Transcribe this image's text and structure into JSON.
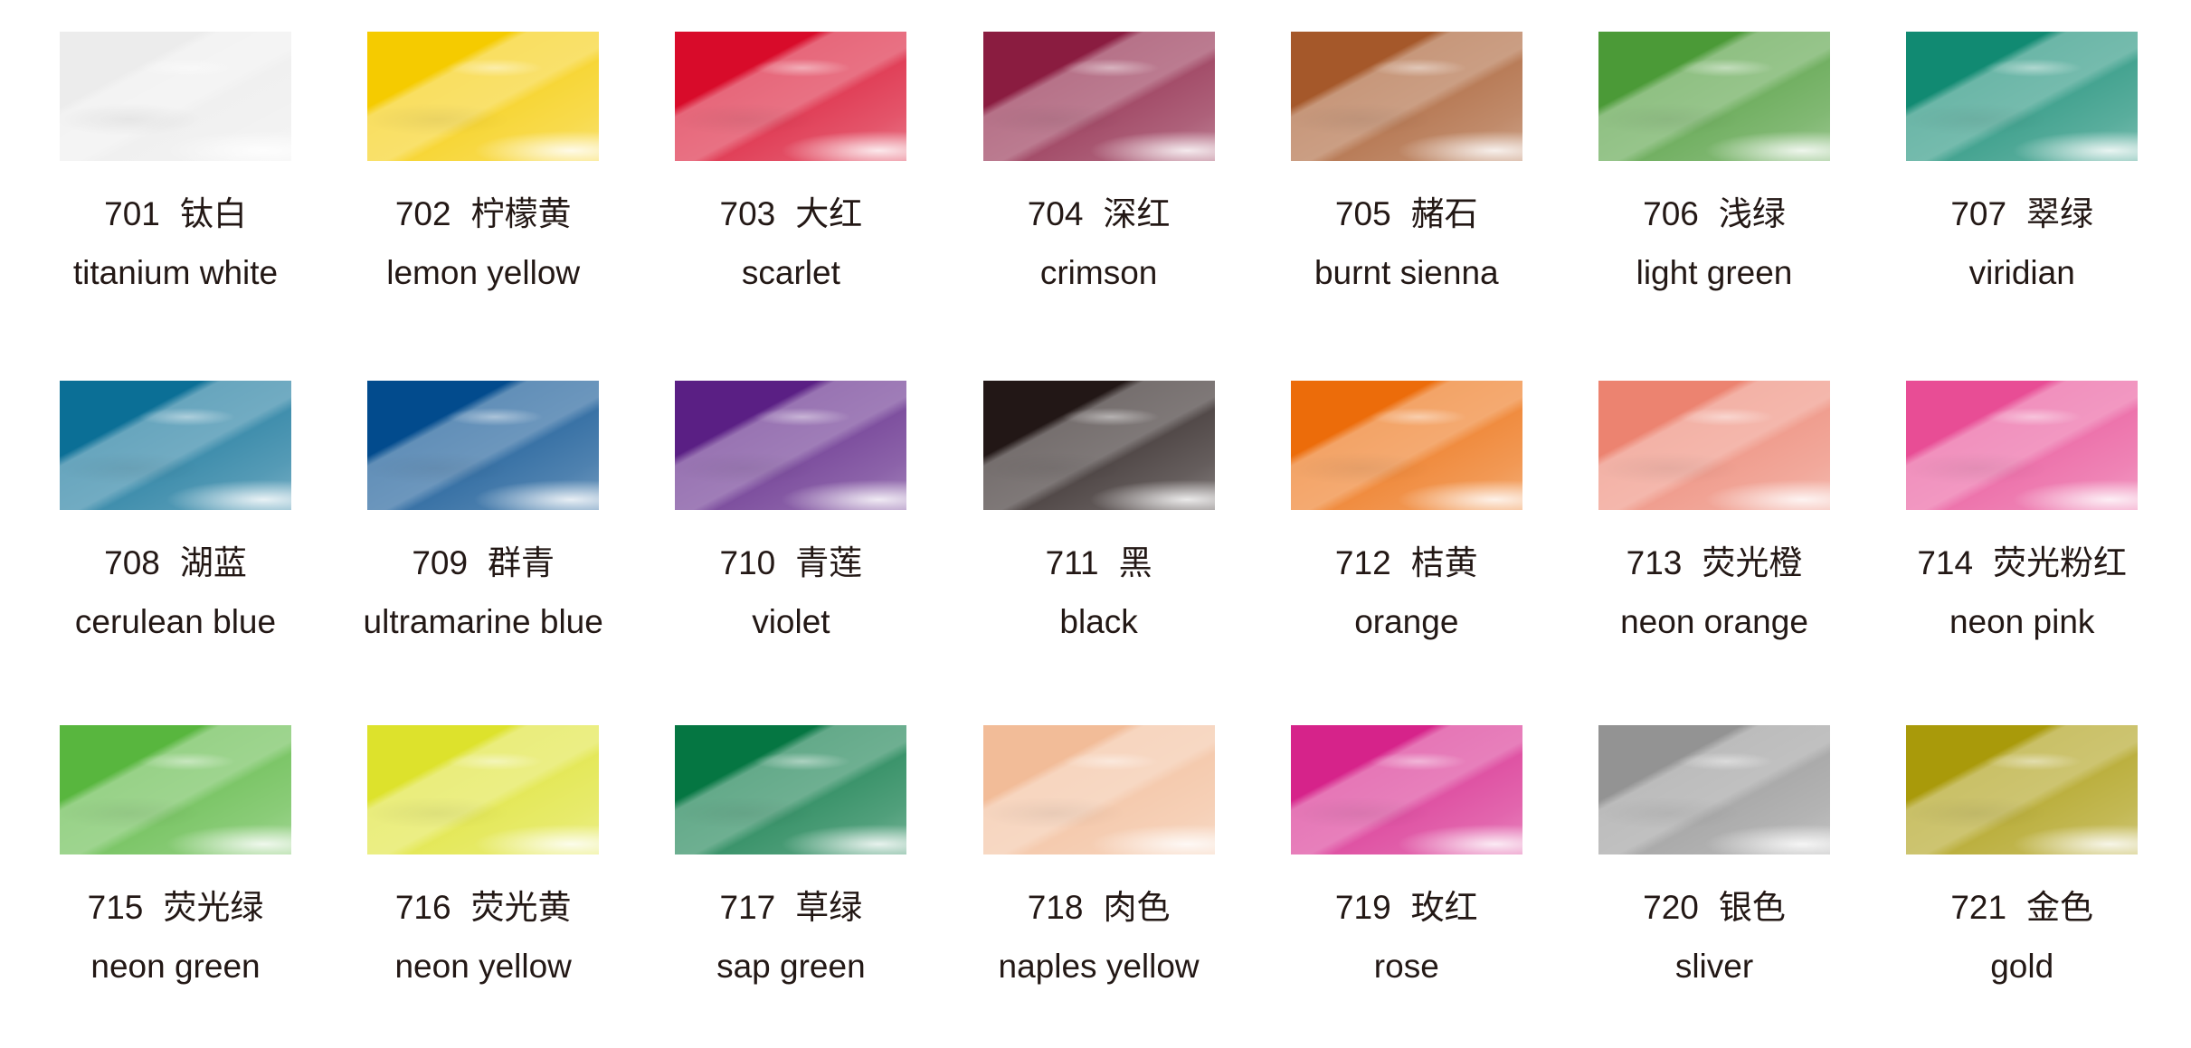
{
  "palette": {
    "items": [
      {
        "code": "701",
        "zh": "钛白",
        "en": "titanium white",
        "color": "#ececec"
      },
      {
        "code": "702",
        "zh": "柠檬黄",
        "en": "lemon yellow",
        "color": "#f5cb00"
      },
      {
        "code": "703",
        "zh": "大红",
        "en": "scarlet",
        "color": "#d80b2a"
      },
      {
        "code": "704",
        "zh": "深红",
        "en": "crimson",
        "color": "#8a1c40"
      },
      {
        "code": "705",
        "zh": "赭石",
        "en": "burnt sienna",
        "color": "#a5582a"
      },
      {
        "code": "706",
        "zh": "浅绿",
        "en": "light green",
        "color": "#4b9a37"
      },
      {
        "code": "707",
        "zh": "翠绿",
        "en": "viridian",
        "color": "#118a72"
      },
      {
        "code": "708",
        "zh": "湖蓝",
        "en": "cerulean blue",
        "color": "#0b6f96"
      },
      {
        "code": "709",
        "zh": "群青",
        "en": "ultramarine blue",
        "color": "#024b8d"
      },
      {
        "code": "710",
        "zh": "青莲",
        "en": "violet",
        "color": "#5a1f84"
      },
      {
        "code": "711",
        "zh": "黑",
        "en": "black",
        "color": "#221716"
      },
      {
        "code": "712",
        "zh": "桔黄",
        "en": "orange",
        "color": "#ec6c0a"
      },
      {
        "code": "713",
        "zh": "荧光橙",
        "en": "neon orange",
        "color": "#ec8370"
      },
      {
        "code": "714",
        "zh": "荧光粉红",
        "en": "neon pink",
        "color": "#e84d95"
      },
      {
        "code": "715",
        "zh": "荧光绿",
        "en": "neon green",
        "color": "#58b63e"
      },
      {
        "code": "716",
        "zh": "荧光黄",
        "en": "neon yellow",
        "color": "#dde22c"
      },
      {
        "code": "717",
        "zh": "草绿",
        "en": "sap green",
        "color": "#057642"
      },
      {
        "code": "718",
        "zh": "肉色",
        "en": "naples yellow",
        "color": "#f2bc98"
      },
      {
        "code": "719",
        "zh": "玫红",
        "en": "rose",
        "color": "#d6238a"
      },
      {
        "code": "720",
        "zh": "银色",
        "en": "sliver",
        "color": "#939393"
      },
      {
        "code": "721",
        "zh": "金色",
        "en": "gold",
        "color": "#a99a0a"
      }
    ]
  }
}
